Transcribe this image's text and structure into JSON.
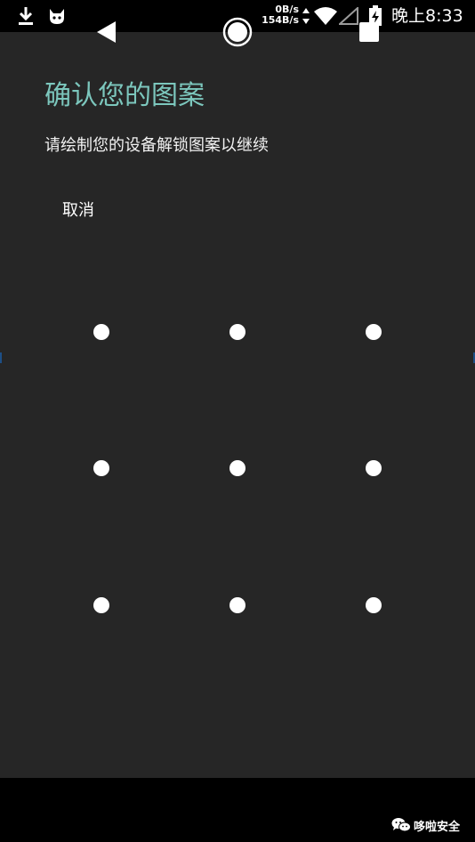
{
  "status_bar": {
    "download_speed": "0B/s",
    "upload_speed": "154B/s",
    "time": "晚上8:33",
    "icons": [
      "download-icon",
      "app-notification-icon",
      "network-arrows-icon",
      "wifi-icon",
      "signal-icon",
      "battery-charging-icon"
    ]
  },
  "page": {
    "title": "确认您的图案",
    "subtitle": "请绘制您的设备解锁图案以继续",
    "cancel_label": "取消"
  },
  "pattern": {
    "rows": 3,
    "columns": 3
  },
  "nav_bar": {
    "icons": [
      "back-icon",
      "home-icon",
      "recents-icon"
    ]
  },
  "watermark": {
    "text": "哆啦安全"
  },
  "colors": {
    "background": "#262626",
    "title": "#7cc7bd",
    "text": "#f2f2f2",
    "dot": "#ffffff",
    "bars": "#000000"
  }
}
